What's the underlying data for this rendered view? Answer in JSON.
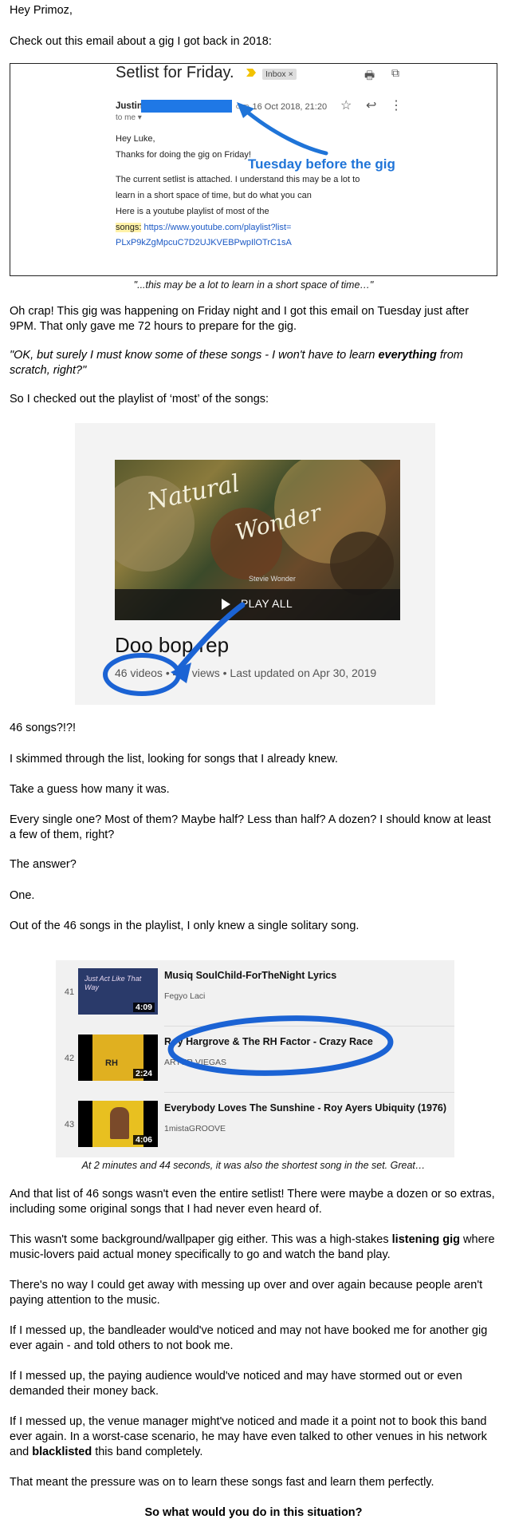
{
  "greeting": "Hey Primoz,",
  "intro": "Check out this email about a gig I got back in 2018:",
  "email": {
    "subject": "Setlist for Friday.",
    "badge": "Inbox",
    "badge_close": "×",
    "sender": "Justin",
    "date": "16 Oct 2018, 21:20",
    "to": "to me",
    "lines": [
      "Hey Luke,",
      "Thanks for doing the gig on Friday!",
      "The current setlist is attached. I understand this may be a lot to",
      "learn in a short space of time, but do what you can",
      "Here is a youtube playlist of most of the"
    ],
    "songs_prefix": "songs:",
    "link_1": "https://www.youtube.com/playlist?list=",
    "link_2": "PLxP9kZgMpcuC7D2UJKVEBPwpIlOTrC1sA",
    "annotation": "Tuesday before the gig",
    "colors": {
      "redaction": "#1f78e6",
      "annotation": "#1f74d8"
    }
  },
  "caption_email": "\"...this may be a lot to learn in a short space of time…\"",
  "p1": "Oh crap! This gig was happening on Friday night and I got this email on Tuesday just after 9PM. That only gave me 72 hours to prepare for the gig.",
  "quote_before": "\"OK, but surely I must know some of these songs - I won't have to learn ",
  "quote_bold": "everything",
  "quote_after": " from scratch, right?\"",
  "p2": "So I checked out the playlist of ‘most’ of the songs:",
  "playlist": {
    "art_title_1": "Natural",
    "art_title_2": "Wonder",
    "art_caption": "Stevie Wonder",
    "play_all": "PLAY ALL",
    "name": "Doo bop rep",
    "videos": "46 videos",
    "meta_rest": " • 4·6 views • Last updated on Apr 30, 2019"
  },
  "p3": "46 songs?!?!",
  "p4": "I skimmed through the list, looking for songs that I already knew.",
  "p5": "Take a guess how many it was.",
  "p6": "Every single one? Most of them? Maybe half? Less than half? A dozen? I should know at least a few of them, right?",
  "p7": "The answer?",
  "p8": "One.",
  "p9": "Out of the 46 songs in the playlist, I only knew a single solitary song.",
  "tracks": [
    {
      "num": "41",
      "title": "Musiq SoulChild-ForTheNight Lyrics",
      "channel": "Fegyo Laci",
      "duration": "4:09",
      "thumb_text": "Just Act Like That Way"
    },
    {
      "num": "42",
      "title": "Roy Hargrove & The RH Factor - Crazy Race",
      "channel": "ARTUR VIEGAS",
      "duration": "2:24",
      "thumb_text": "RH"
    },
    {
      "num": "43",
      "title": "Everybody Loves The Sunshine - Roy Ayers Ubiquity (1976)",
      "channel": "1mistaGROOVE",
      "duration": "4:06",
      "thumb_text": ""
    }
  ],
  "caption_tracks": "At 2 minutes and 44 seconds, it was also the shortest song in the set. Great…",
  "p10": "And that list of 46 songs wasn't even the entire setlist! There were maybe a dozen or so extras, including some original songs that I had never even heard of.",
  "p11_before": "This wasn't some background/wallpaper gig either. This was a high-stakes ",
  "p11_bold": "listening gig",
  "p11_after": " where music-lovers paid actual money specifically to go and watch the band play.",
  "p12": "There's no way I could get away with messing up over and over again because people aren't paying attention to the music.",
  "p13": "If I messed up, the bandleader would've noticed and may not have booked me for another gig ever again - and told others to not book me.",
  "p14": "If I messed up, the paying audience would've noticed and may have stormed out or even demanded their money back.",
  "p15_before": "If I messed up, the venue manager might've noticed and made it a point not to book this band ever again. In a worst-case scenario, he may have even talked to other venues in his network and ",
  "p15_bold": "blacklisted",
  "p15_after": " this band completely.",
  "p16": "That meant the pressure was on to learn these songs fast and learn them perfectly.",
  "closing": "So what would you do in this situation?",
  "marker_color": "#1b63d4"
}
